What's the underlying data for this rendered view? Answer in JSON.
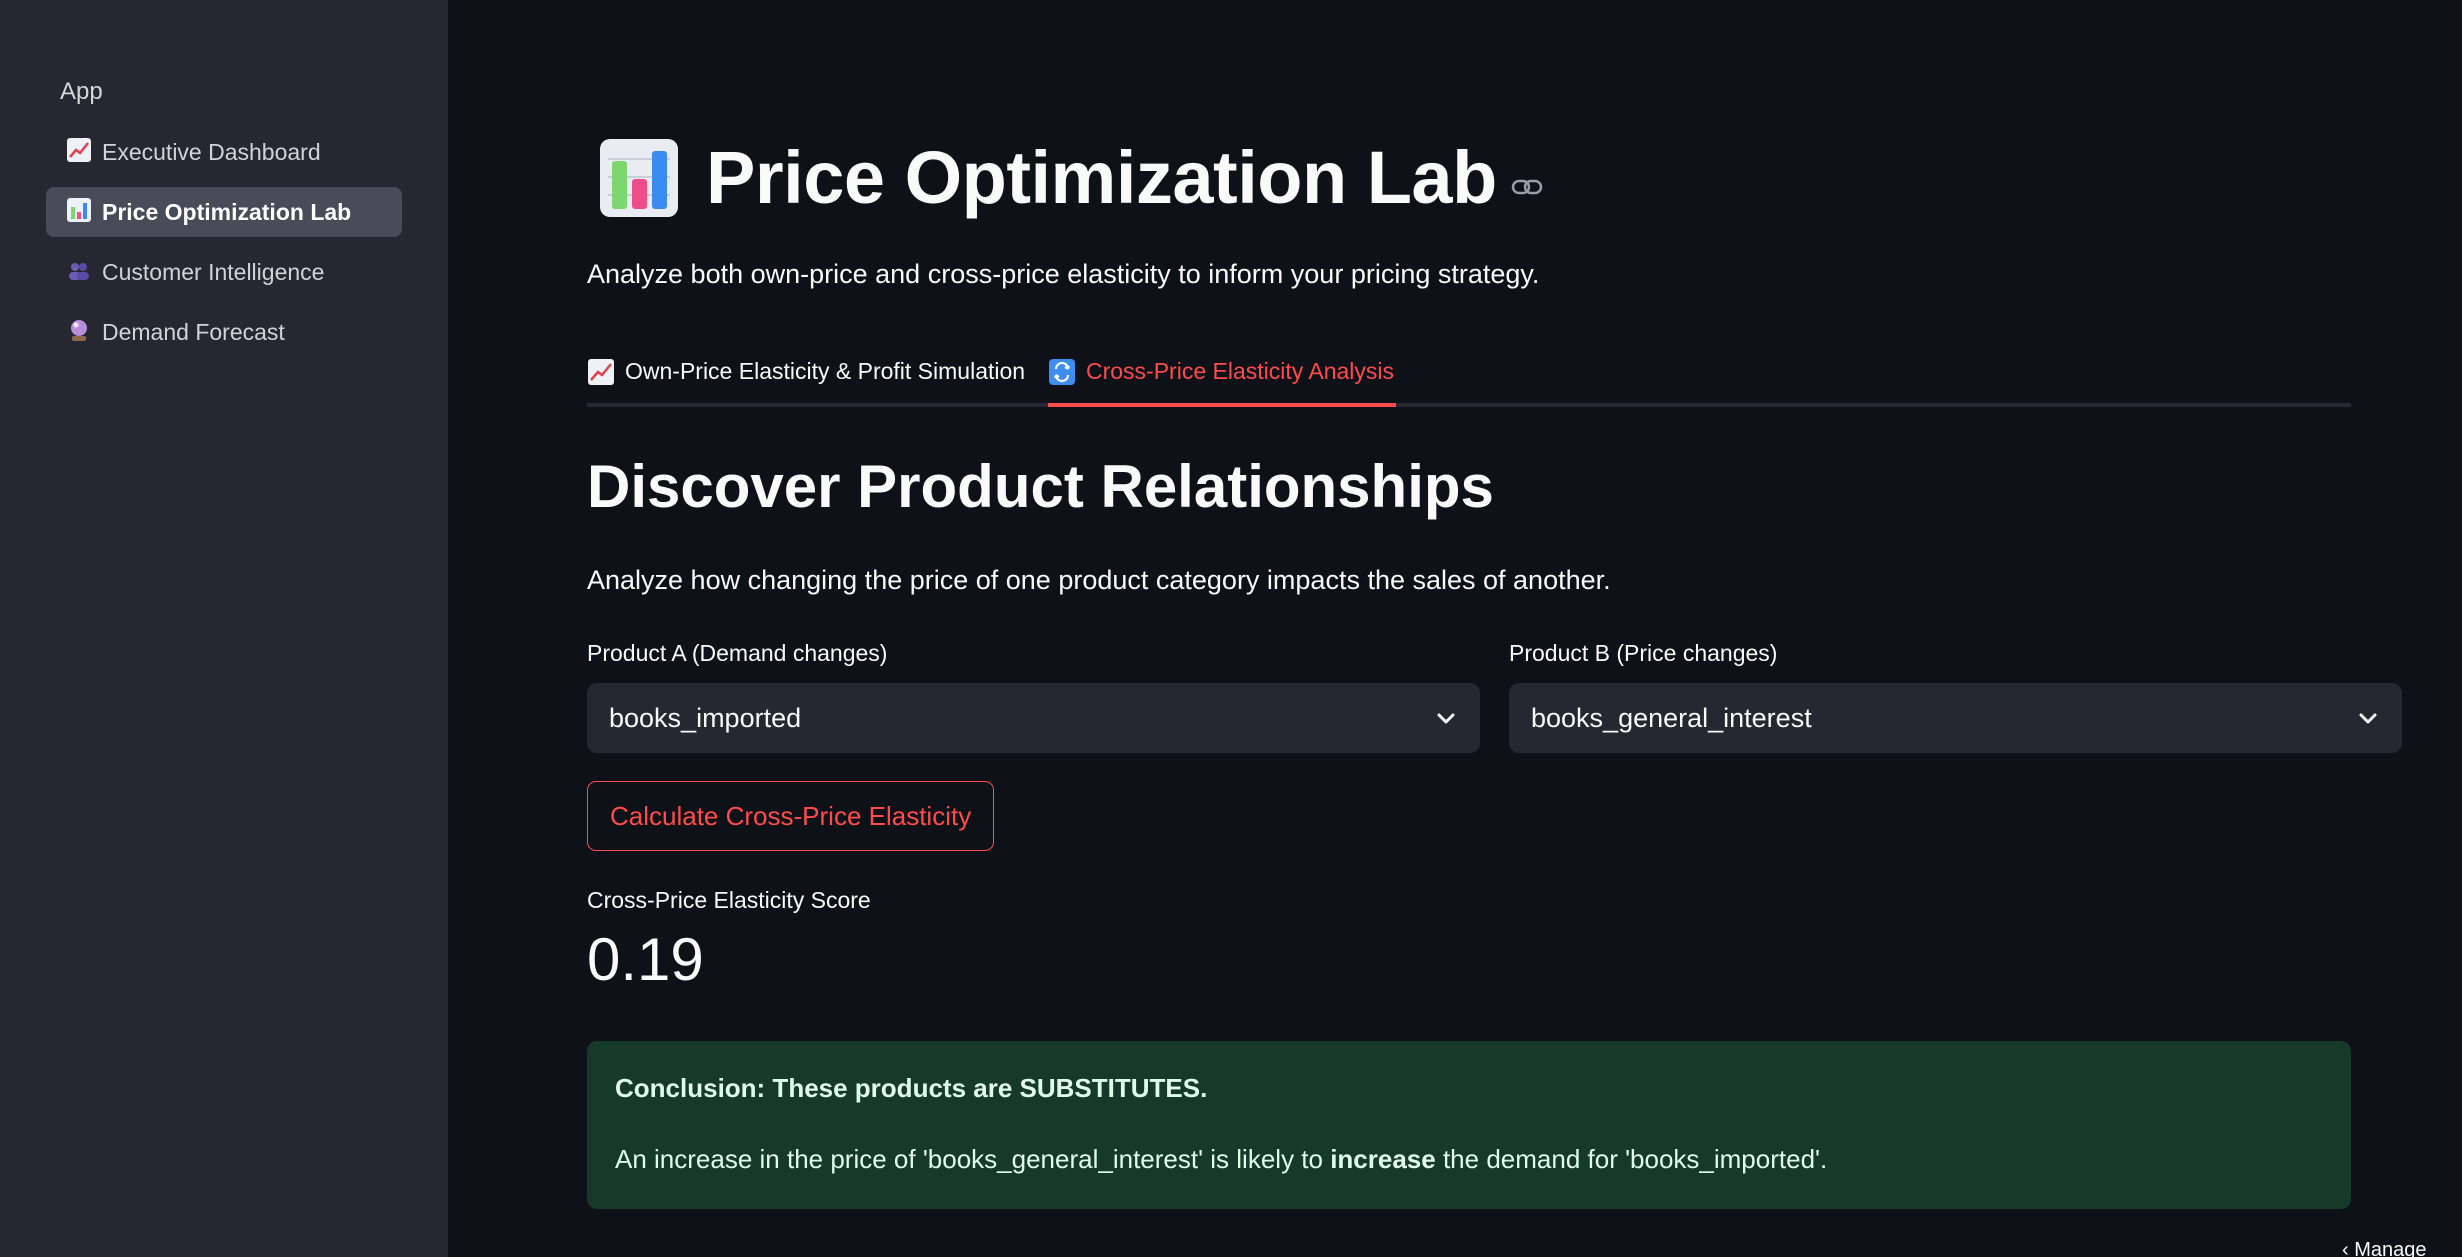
{
  "sidebar": {
    "heading": "App",
    "items": [
      {
        "label": "Executive Dashboard",
        "icon": "chart-increasing-icon",
        "active": false
      },
      {
        "label": "Price Optimization Lab",
        "icon": "bar-chart-icon",
        "active": true
      },
      {
        "label": "Customer Intelligence",
        "icon": "people-icon",
        "active": false
      },
      {
        "label": "Demand Forecast",
        "icon": "crystal-ball-icon",
        "active": false
      }
    ]
  },
  "header": {
    "title": "Price Optimization Lab",
    "title_icon": "bar-chart-icon",
    "subtitle": "Analyze both own-price and cross-price elasticity to inform your pricing strategy."
  },
  "tabs": [
    {
      "label": "Own-Price Elasticity & Profit Simulation",
      "icon": "chart-increasing-icon",
      "active": false
    },
    {
      "label": "Cross-Price Elasticity Analysis",
      "icon": "repeat-icon",
      "active": true
    }
  ],
  "section": {
    "title": "Discover Product Relationships",
    "description": "Analyze how changing the price of one product category impacts the sales of another."
  },
  "product_a": {
    "label": "Product A (Demand changes)",
    "value": "books_imported"
  },
  "product_b": {
    "label": "Product B (Price changes)",
    "value": "books_general_interest"
  },
  "calculate_button": "Calculate Cross-Price Elasticity",
  "metric": {
    "label": "Cross-Price Elasticity Score",
    "value": "0.19"
  },
  "conclusion": {
    "title": "Conclusion: These products are SUBSTITUTES.",
    "body_pre": "An increase in the price of 'books_general_interest' is likely to ",
    "body_bold": "increase",
    "body_post": " the demand for 'books_imported'."
  },
  "footer": {
    "manage_app": "Manage app"
  },
  "colors": {
    "accent": "#ff4b4b",
    "background": "#0e1117",
    "sidebar": "#262730",
    "success_bg": "#173928"
  }
}
